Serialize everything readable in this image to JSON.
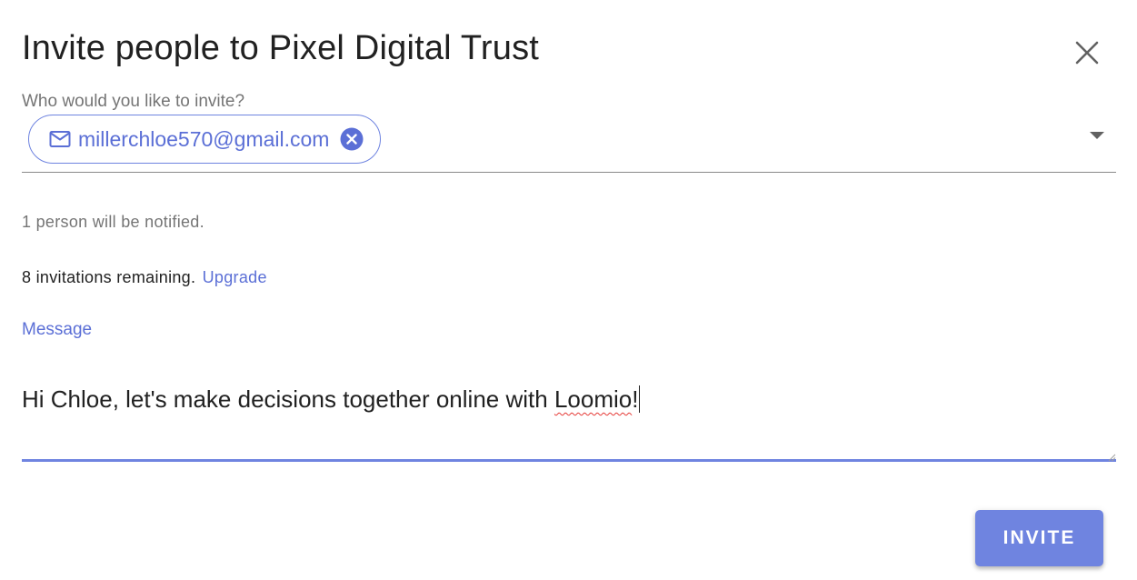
{
  "dialog": {
    "title": "Invite people to Pixel Digital Trust",
    "close_icon": "close-icon"
  },
  "recipients": {
    "label": "Who would you like to invite?",
    "chips": [
      {
        "email": "millerchloe570@gmail.com",
        "icon": "mail-icon",
        "remove_icon": "cancel-circle-icon"
      }
    ],
    "dropdown_icon": "dropdown-arrow-icon"
  },
  "status": {
    "notified": "1 person will be notified.",
    "remaining": "8 invitations remaining.",
    "upgrade_link": "Upgrade"
  },
  "message": {
    "label": "Message",
    "text_before": "Hi Chloe, let's make decisions together online with ",
    "text_misspelled": "Loomio",
    "text_after": "!"
  },
  "actions": {
    "invite_label": "INVITE"
  },
  "colors": {
    "accent": "#6f84e0",
    "accent_text": "#5b6fd6",
    "secondary_text": "#757575",
    "spellcheck": "#e53935"
  }
}
